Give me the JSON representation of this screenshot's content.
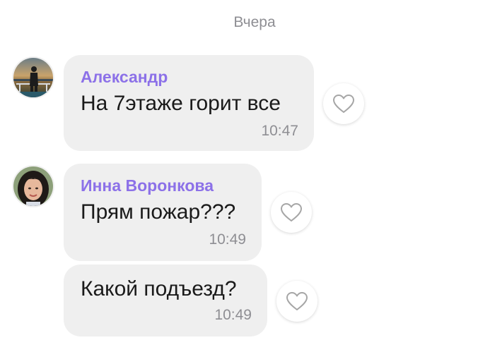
{
  "date_separator": "Вчера",
  "messages": [
    {
      "sender": "Александр",
      "text": "На 7этаже горит все",
      "time": "10:47"
    },
    {
      "sender": "Инна Воронкова",
      "text": "Прям пожар???",
      "time": "10:49"
    },
    {
      "sender": "",
      "text": "Какой подъезд?",
      "time": "10:49"
    }
  ],
  "icons": {
    "like": "heart-outline-icon",
    "avatar_1": "man-on-boat-photo",
    "avatar_2": "woman-dark-hair-photo"
  },
  "colors": {
    "sender_name": "#8c71e8",
    "bubble": "#efefef",
    "secondary_text": "#8e8e93"
  }
}
